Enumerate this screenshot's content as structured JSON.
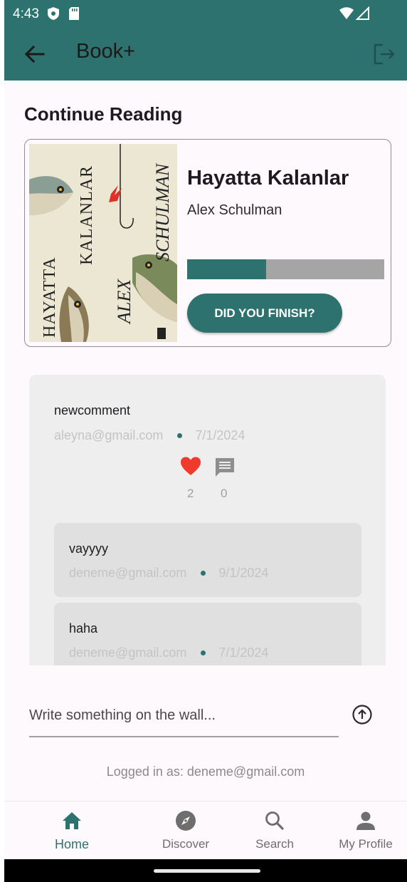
{
  "status_bar": {
    "time": "4:43"
  },
  "app_bar": {
    "title": "Book+"
  },
  "continue_reading": {
    "heading": "Continue Reading",
    "book": {
      "title": "Hayatta Kalanlar",
      "author": "Alex Schulman",
      "progress_fraction": 0.4,
      "cover_text": {
        "title_line_1": "HAYATTA",
        "title_line_2": "KALANLAR",
        "author_line_1": "ALEX",
        "author_line_2": "SCHULMAN"
      }
    },
    "finish_button": "DID YOU FINISH?"
  },
  "wall": {
    "post": {
      "text": "newcomment",
      "author": "aleyna@gmail.com",
      "date": "7/1/2024",
      "likes": "2",
      "comments": "0"
    },
    "replies": [
      {
        "text": "vayyyy",
        "author": "deneme@gmail.com",
        "date": "9/1/2024"
      },
      {
        "text": "haha",
        "author": "deneme@gmail.com",
        "date": "7/1/2024"
      }
    ]
  },
  "composer": {
    "placeholder": "Write something on the wall..."
  },
  "logged_in": "Logged in as: deneme@gmail.com",
  "bottom_nav": [
    {
      "label": "Home",
      "icon": "home-icon",
      "active": true
    },
    {
      "label": "Discover",
      "icon": "compass-icon",
      "active": false
    },
    {
      "label": "Search",
      "icon": "search-icon",
      "active": false
    },
    {
      "label": "My Profile",
      "icon": "person-icon",
      "active": false
    }
  ],
  "colors": {
    "primary": "#2e726f",
    "like": "#ef3b2d",
    "wall_bg": "#eeeeee",
    "reply_bg": "#e0e0e0"
  }
}
